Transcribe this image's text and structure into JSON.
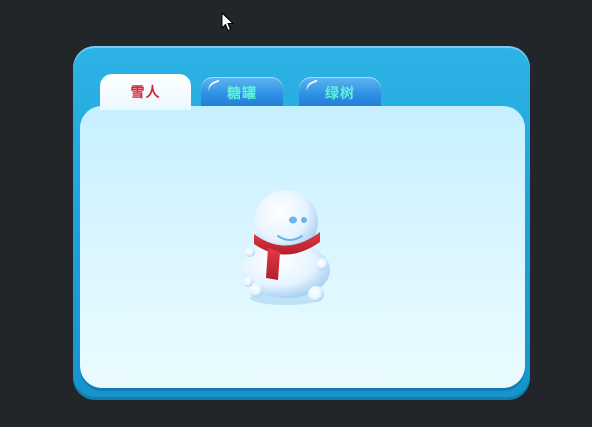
{
  "tabs": [
    {
      "label": "雪人",
      "active": true
    },
    {
      "label": "糖罐",
      "active": false
    },
    {
      "label": "绿树",
      "active": false
    }
  ],
  "content": {
    "image": "snowman-with-red-scarf"
  },
  "colors": {
    "background": "#22252a",
    "panel": "#1d9fd6",
    "active_tab_text": "#d42535",
    "inactive_tab_text": "#5ff0d6"
  }
}
